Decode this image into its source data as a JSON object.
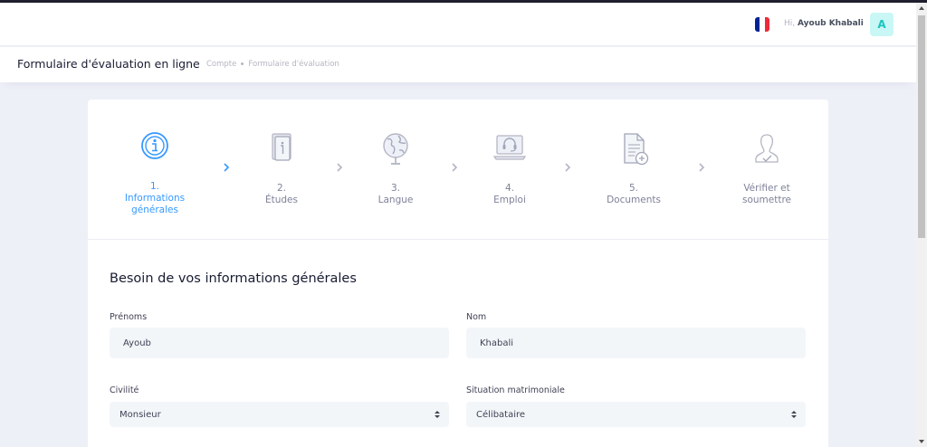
{
  "header": {
    "greeting_prefix": "Hi,",
    "user_name": "Ayoub Khabali",
    "avatar_letter": "A",
    "language_flag": "flag-france-icon"
  },
  "subheader": {
    "title": "Formulaire d'évaluation en ligne",
    "breadcrumb": [
      "Compte",
      "Formulaire d'évaluation"
    ]
  },
  "wizard": {
    "steps": [
      {
        "number": "1.",
        "label_line1": "Informations",
        "label_line2": "générales",
        "icon": "info-circle-icon",
        "active": true
      },
      {
        "number": "2.",
        "label_line1": "Études",
        "label_line2": "",
        "icon": "book-icon",
        "active": false
      },
      {
        "number": "3.",
        "label_line1": "Langue",
        "label_line2": "",
        "icon": "globe-icon",
        "active": false
      },
      {
        "number": "4.",
        "label_line1": "Emploi",
        "label_line2": "",
        "icon": "laptop-headset-icon",
        "active": false
      },
      {
        "number": "5.",
        "label_line1": "Documents",
        "label_line2": "",
        "icon": "document-add-icon",
        "active": false
      },
      {
        "number": "",
        "label_line1": "Vérifier et",
        "label_line2": "soumettre",
        "icon": "user-check-icon",
        "active": false
      }
    ]
  },
  "form": {
    "title": "Besoin de vos informations générales",
    "prenoms": {
      "label": "Prénoms",
      "value": "Ayoub"
    },
    "nom": {
      "label": "Nom",
      "value": "Khabali"
    },
    "civilite": {
      "label": "Civilité",
      "value": "Monsieur"
    },
    "situation": {
      "label": "Situation matrimoniale",
      "value": "Célibataire"
    }
  },
  "colors": {
    "accent": "#3699ff",
    "avatar_bg": "#c9f7f5",
    "avatar_fg": "#1bc5bd",
    "page_bg": "#eef0f8",
    "input_bg": "#f3f6f9"
  }
}
